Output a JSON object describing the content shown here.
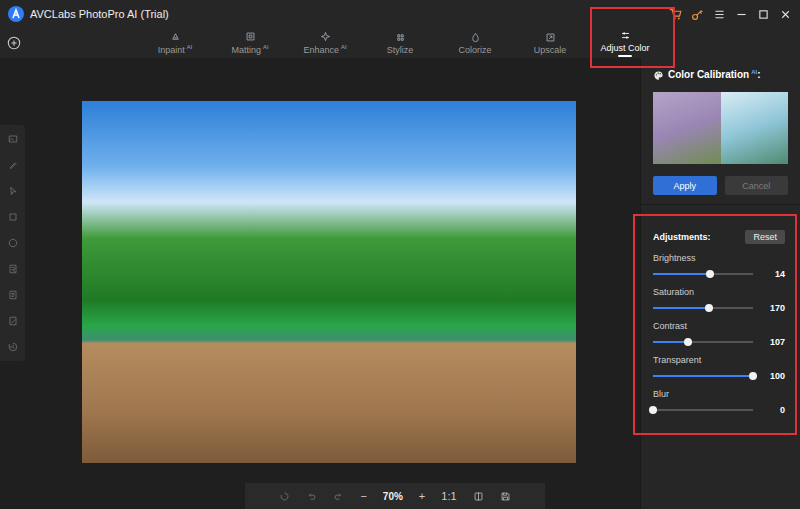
{
  "window": {
    "title": "AVCLabs PhotoPro AI (Trial)"
  },
  "tabs": [
    {
      "label": "Inpaint",
      "badge": "AI",
      "selected": false,
      "highlighted": false
    },
    {
      "label": "Matting",
      "badge": "AI",
      "selected": false,
      "highlighted": false
    },
    {
      "label": "Enhance",
      "badge": "AI",
      "selected": false,
      "highlighted": false
    },
    {
      "label": "Stylize",
      "selected": false,
      "highlighted": false
    },
    {
      "label": "Colorize",
      "selected": false,
      "highlighted": false
    },
    {
      "label": "Upscale",
      "selected": false,
      "highlighted": false
    },
    {
      "label": "Adjust Color",
      "selected": true,
      "highlighted": true
    }
  ],
  "color_calibration": {
    "title": "Color Calibration",
    "badge": "AI",
    "suffix": ":",
    "apply": {
      "label": "Apply",
      "disabled": false
    },
    "cancel": {
      "label": "Cancel",
      "disabled": true
    }
  },
  "adjustments": {
    "title": "Adjustments:",
    "reset": "Reset",
    "highlighted": true,
    "sliders": [
      {
        "label": "Brightness",
        "level": 0.57,
        "reading": "14"
      },
      {
        "label": "Saturation",
        "level": 0.56,
        "reading": "170"
      },
      {
        "label": "Contrast",
        "level": 0.35,
        "reading": "107"
      },
      {
        "label": "Transparent",
        "level": 1.0,
        "reading": "100"
      },
      {
        "label": "Blur",
        "level": 0.0,
        "reading": "0"
      }
    ]
  },
  "zoom": {
    "out": "−",
    "value": "70%",
    "in": "+",
    "actual": "1:1"
  }
}
